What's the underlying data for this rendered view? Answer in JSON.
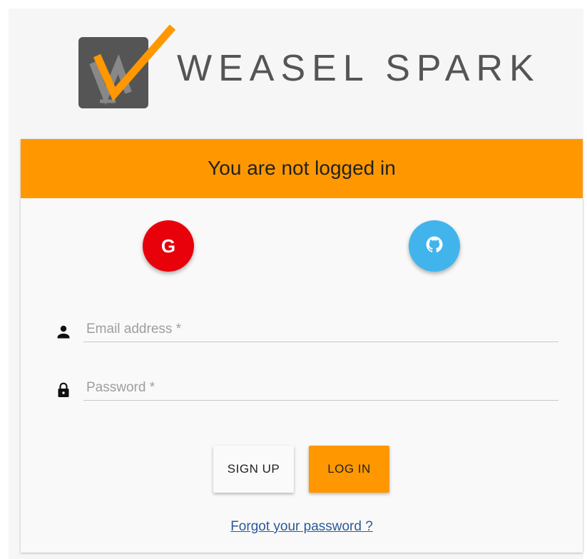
{
  "brand": {
    "name": "WEASEL SPARK",
    "logo_icon": "weasel-spark-logo-icon"
  },
  "status": {
    "message": "You are not logged in",
    "color": "#ff9800"
  },
  "social": {
    "google": {
      "glyph": "G",
      "icon": "google-icon",
      "color": "#e8000b"
    },
    "github": {
      "icon": "github-icon",
      "color": "#42b4ec"
    }
  },
  "form": {
    "email": {
      "placeholder": "Email address *",
      "value": "",
      "icon": "person-icon"
    },
    "password": {
      "placeholder": "Password *",
      "value": "",
      "icon": "lock-icon"
    }
  },
  "actions": {
    "signup_label": "SIGN UP",
    "login_label": "LOG IN"
  },
  "forgot_password": "Forgot your password ?"
}
